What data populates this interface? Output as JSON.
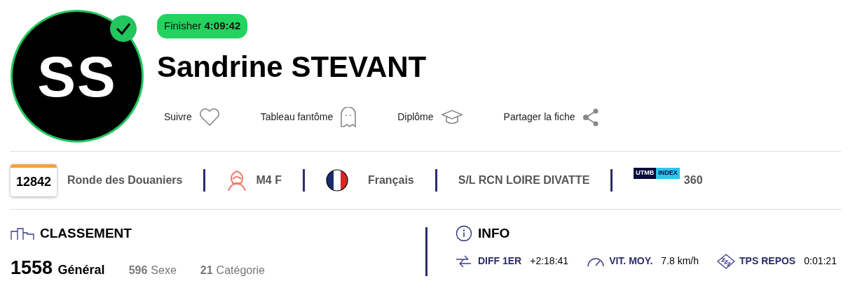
{
  "avatar": {
    "initials": "SS",
    "finished": true
  },
  "badge": {
    "label": "Finisher",
    "time": "4:09:42"
  },
  "name": "Sandrine STEVANT",
  "actions": [
    {
      "label": "Suivre",
      "kind": "heart"
    },
    {
      "label": "Tableau fantôme",
      "kind": "ghost"
    },
    {
      "label": "Diplôme",
      "kind": "cap"
    },
    {
      "label": "Partager la fiche",
      "kind": "share"
    }
  ],
  "bib": "12842",
  "details": [
    {
      "kind": "race",
      "text": "Ronde des Douaniers"
    },
    {
      "kind": "category",
      "text": "M4 F"
    },
    {
      "kind": "nationality",
      "text": "Français"
    },
    {
      "kind": "club",
      "text": "S/L RCN LOIRE DIVATTE"
    },
    {
      "kind": "index",
      "logo": [
        "UTMB",
        "INDEX"
      ],
      "text": "360"
    }
  ],
  "classement": {
    "title": "CLASSEMENT",
    "general": {
      "value": "1558",
      "label": "Général"
    },
    "others": [
      {
        "value": "596",
        "label": "Sexe"
      },
      {
        "value": "21",
        "label": "Catégorie"
      }
    ]
  },
  "info": {
    "title": "INFO",
    "items": [
      {
        "kind": "diff",
        "label": "DIFF 1ER",
        "value": "+2:18:41"
      },
      {
        "kind": "speed",
        "label": "VIT. MOY.",
        "value": "7.8 km/h"
      },
      {
        "kind": "rest",
        "label": "TPS REPOS",
        "value": "0:01:21"
      }
    ]
  }
}
